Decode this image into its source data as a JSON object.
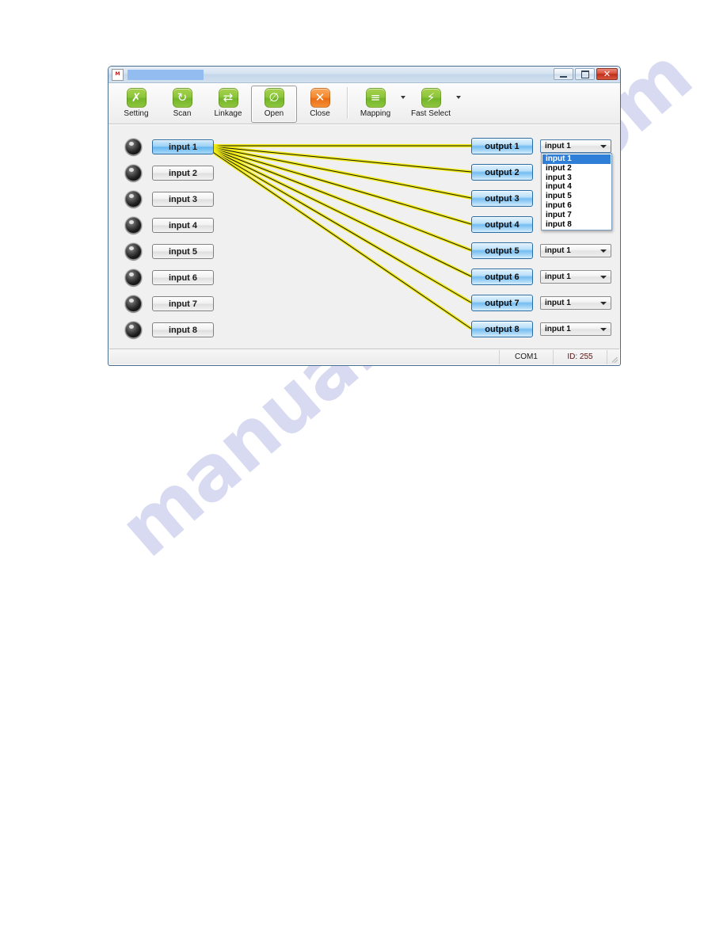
{
  "window": {
    "title": "",
    "title_icon": "app-icon",
    "controls": {
      "minimize": "–",
      "maximize": "☐",
      "close": "✕"
    }
  },
  "toolbar": {
    "items": [
      {
        "label": "Setting",
        "icon": "wrench-icon",
        "color": "#8cc63e",
        "active": false
      },
      {
        "label": "Scan",
        "icon": "refresh-icon",
        "color": "#8cc63e",
        "active": false
      },
      {
        "label": "Linkage",
        "icon": "link-icon",
        "color": "#8cc63e",
        "active": false
      },
      {
        "label": "Open",
        "icon": "power-icon",
        "color": "#8cc63e",
        "active": true
      },
      {
        "label": "Close",
        "icon": "close-x-icon",
        "color": "#f4821f",
        "active": false
      },
      {
        "label": "Mapping",
        "icon": "chart-icon",
        "color": "#8cc63e",
        "active": false
      },
      {
        "label": "Fast Select",
        "icon": "bolt-icon",
        "color": "#8cc63e",
        "active": false
      }
    ],
    "glyphs": {
      "wrench": "⚒",
      "refresh": "↻",
      "link": "⇄",
      "power": "⊘",
      "close_x": "✕",
      "chart": "≡",
      "bolt": "⚡"
    }
  },
  "inputs": [
    {
      "label": "input 1",
      "selected": true
    },
    {
      "label": "input 2",
      "selected": false
    },
    {
      "label": "input 3",
      "selected": false
    },
    {
      "label": "input 4",
      "selected": false
    },
    {
      "label": "input 5",
      "selected": false
    },
    {
      "label": "input 6",
      "selected": false
    },
    {
      "label": "input 7",
      "selected": false
    },
    {
      "label": "input 8",
      "selected": false
    }
  ],
  "outputs": [
    {
      "label": "output 1",
      "source": "input 1",
      "dropdown_open": true
    },
    {
      "label": "output 2",
      "source": "input 1",
      "dropdown_open": false
    },
    {
      "label": "output 3",
      "source": "input 1",
      "dropdown_open": false
    },
    {
      "label": "output 4",
      "source": "input 1",
      "dropdown_open": false
    },
    {
      "label": "output 5",
      "source": "input 1",
      "dropdown_open": false
    },
    {
      "label": "output 6",
      "source": "input 1",
      "dropdown_open": false
    },
    {
      "label": "output 7",
      "source": "input 1",
      "dropdown_open": false
    },
    {
      "label": "output 8",
      "source": "input 1",
      "dropdown_open": false
    }
  ],
  "dropdown": {
    "selected": "input 1",
    "options": [
      "input 1",
      "input 2",
      "input 3",
      "input 4",
      "input 5",
      "input 6",
      "input 7",
      "input 8"
    ]
  },
  "routing": {
    "source": "input 1",
    "targets": [
      "output 1",
      "output 2",
      "output 3",
      "output 4",
      "output 5",
      "output 6",
      "output 7",
      "output 8"
    ],
    "line_color": "#f2ec12",
    "line_core_color": "#141414"
  },
  "statusbar": {
    "com_port": "COM1",
    "device_id": "ID: 255"
  },
  "watermark": {
    "text": "manualshive.com"
  }
}
